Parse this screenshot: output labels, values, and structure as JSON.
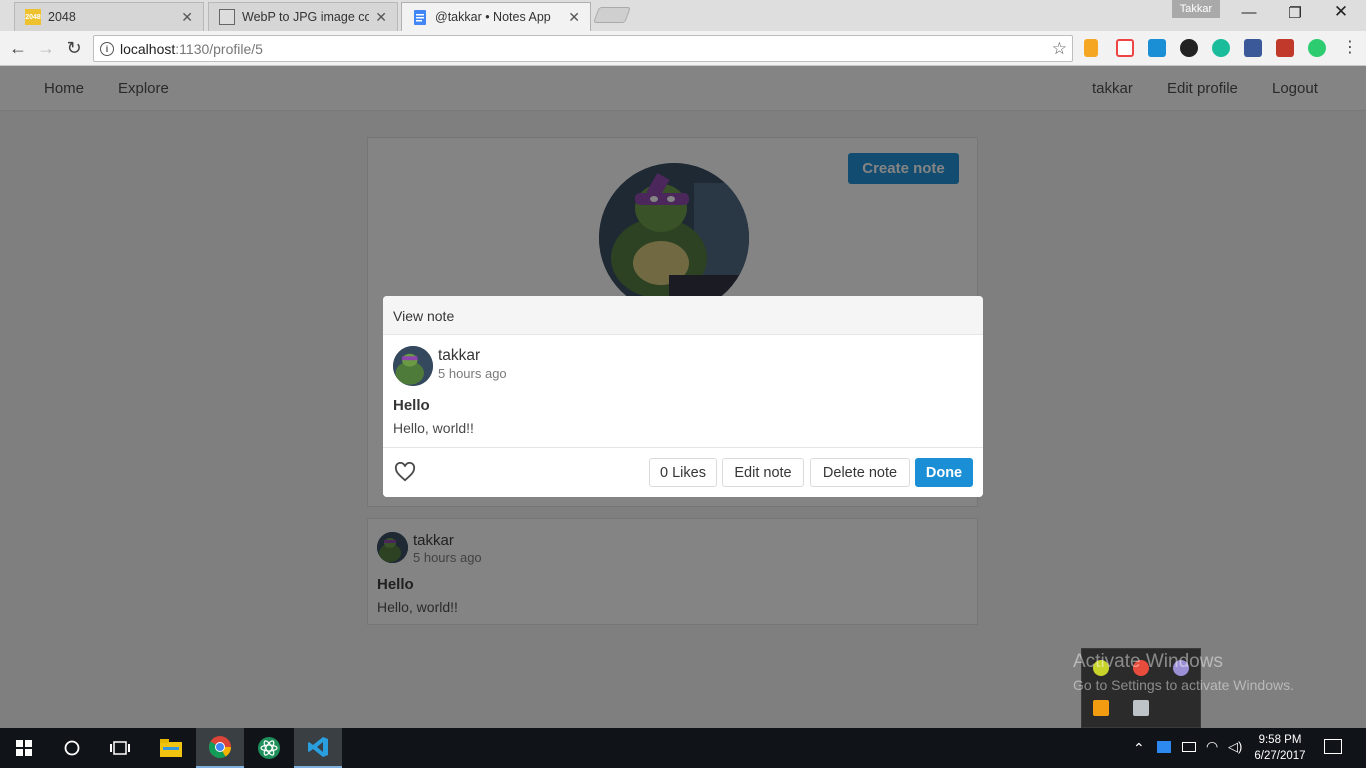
{
  "browser": {
    "tabs": [
      {
        "title": "2048",
        "favicon": "2048"
      },
      {
        "title": "WebP to JPG image conv",
        "favicon": "page-icon"
      },
      {
        "title": "@takkar • Notes App",
        "favicon": "doc-icon"
      }
    ],
    "profile_name": "Takkar",
    "url_host": "localhost",
    "url_path": ":1130/profile/5"
  },
  "navbar": {
    "home": "Home",
    "explore": "Explore",
    "user": "takkar",
    "edit_profile": "Edit profile",
    "logout": "Logout"
  },
  "profile": {
    "create_note": "Create note"
  },
  "modal": {
    "title": "View note",
    "author": "takkar",
    "time": "5 hours ago",
    "note_title": "Hello",
    "note_text": "Hello, world!!",
    "likes": "0 Likes",
    "edit": "Edit note",
    "delete": "Delete note",
    "done": "Done"
  },
  "note_card": {
    "author": "takkar",
    "time": "5 hours ago",
    "note_title": "Hello",
    "note_text": "Hello, world!!"
  },
  "watermark": {
    "line1": "Activate Windows",
    "line2": "Go to Settings to activate Windows."
  },
  "taskbar": {
    "time": "9:58 PM",
    "date": "6/27/2017"
  }
}
